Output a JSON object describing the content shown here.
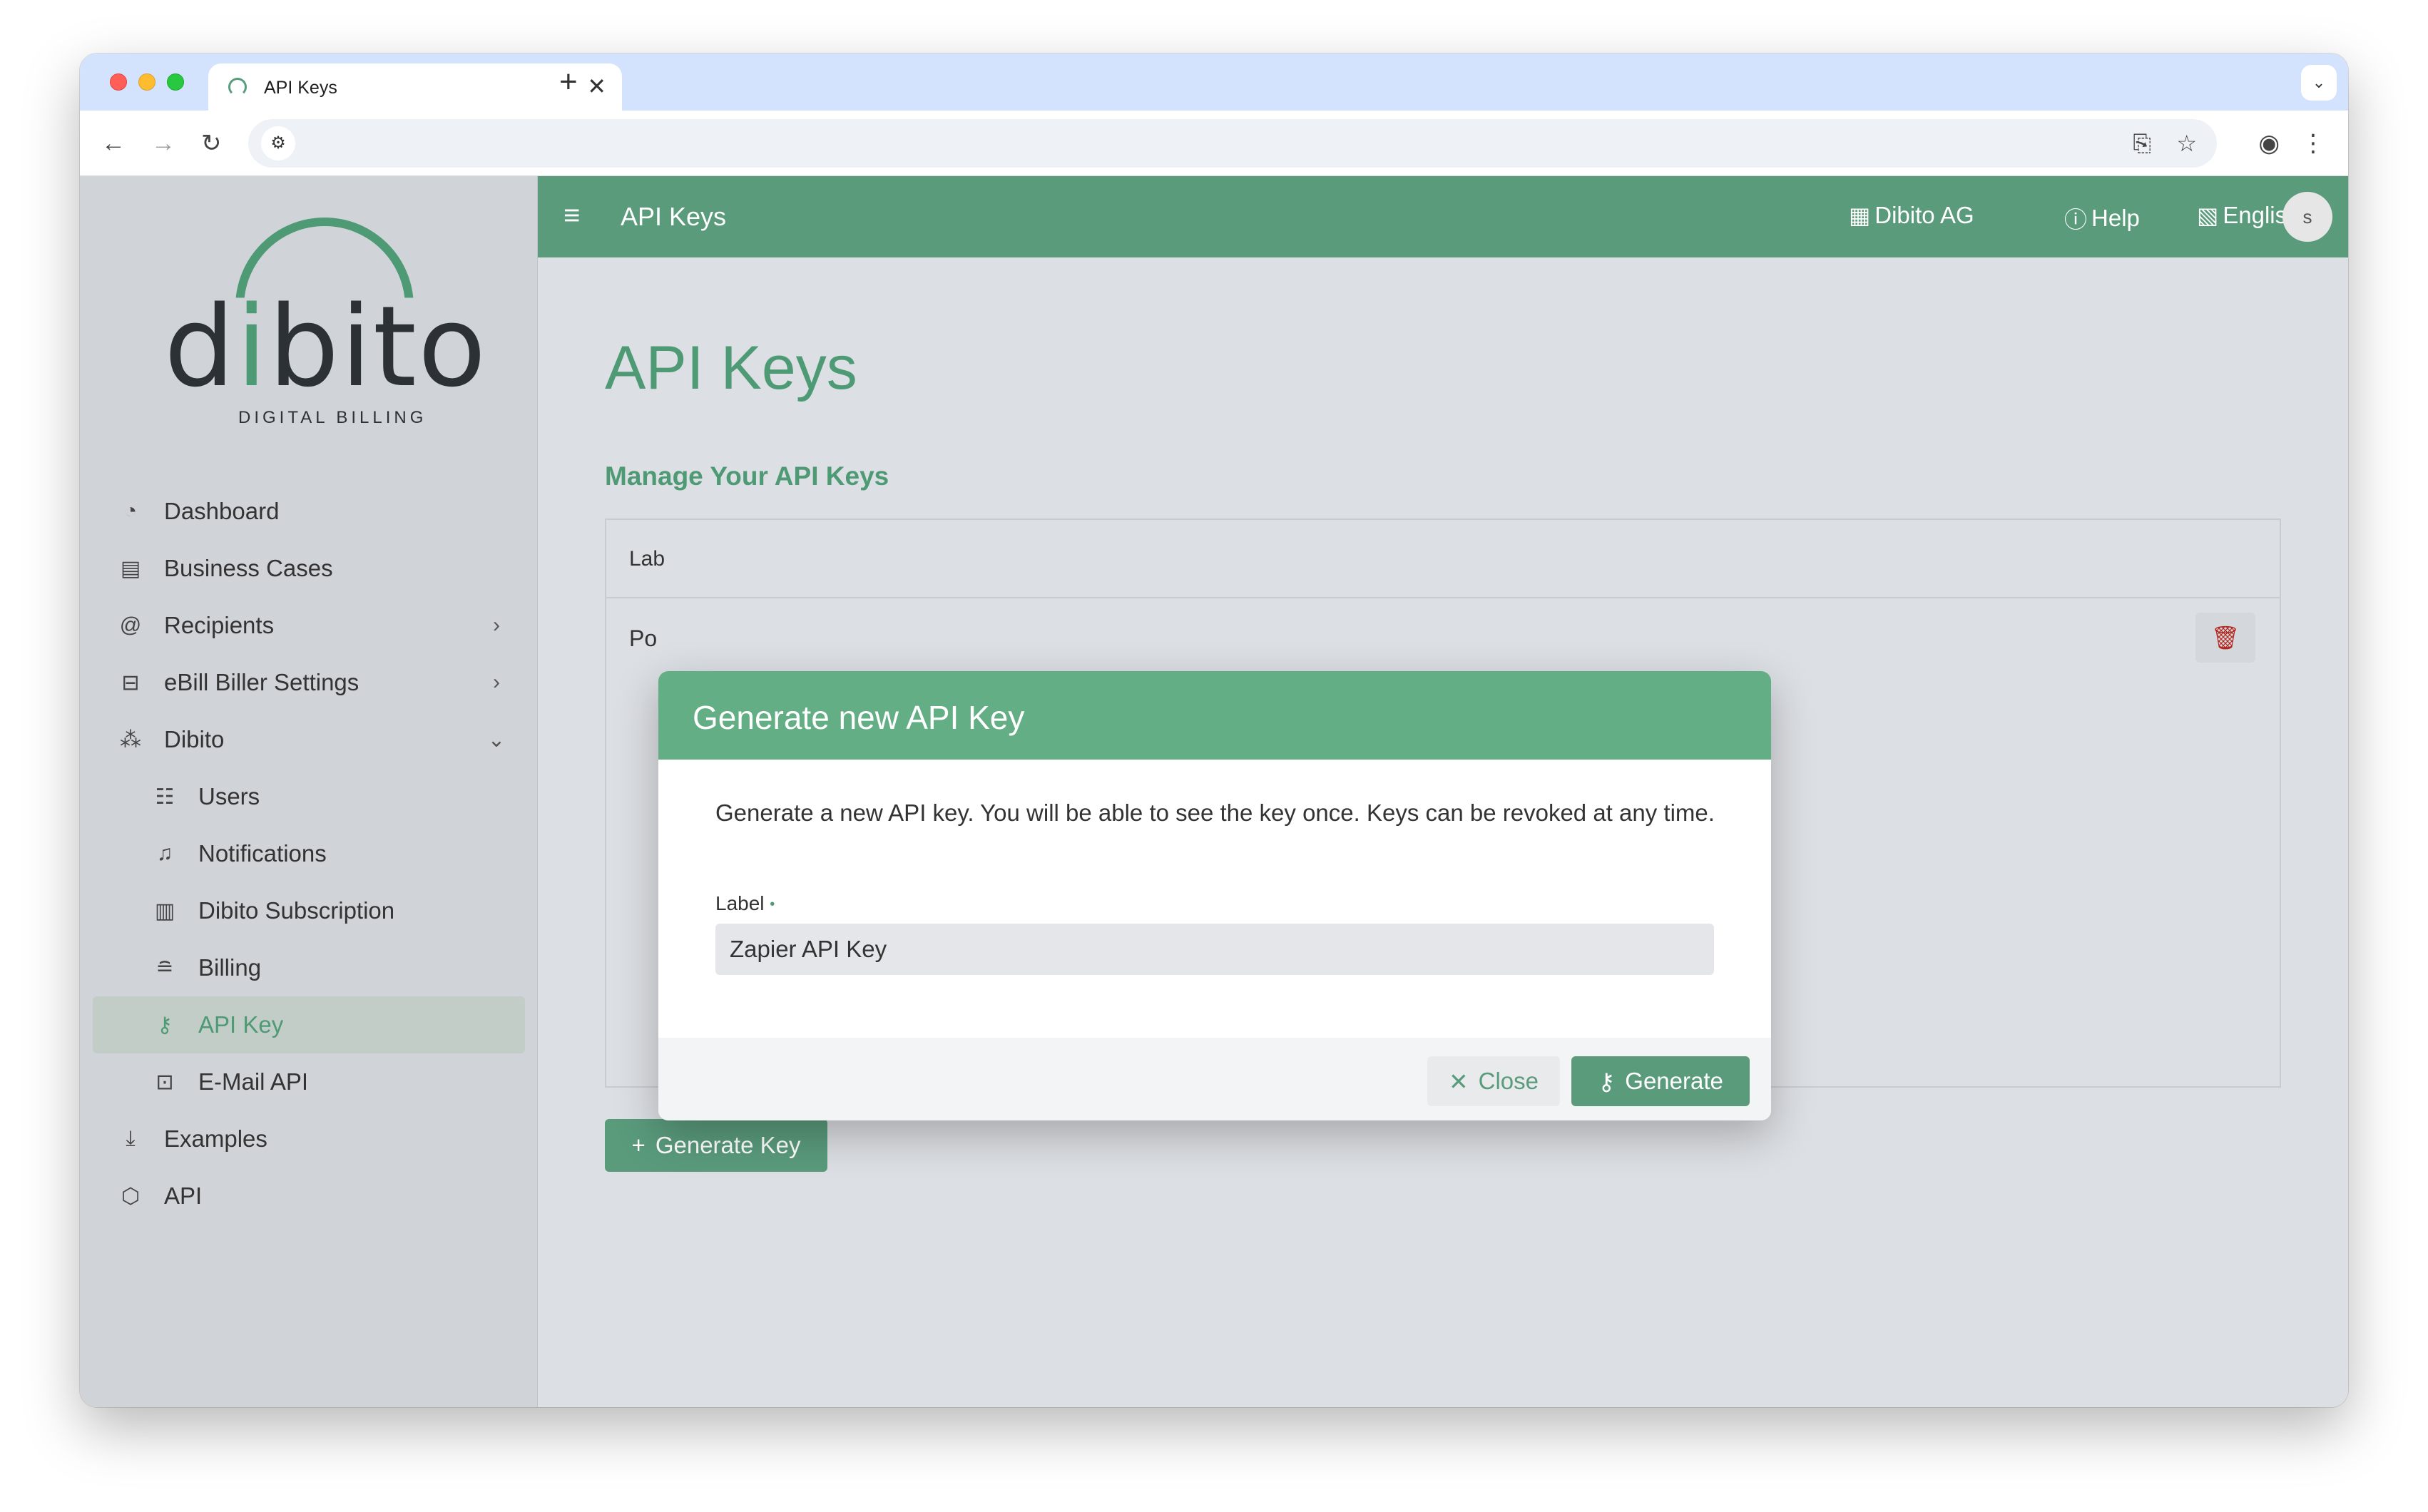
{
  "browser": {
    "tab_title": "API Keys",
    "tab_close": "✕",
    "new_tab": "+",
    "dropdown": "⌄"
  },
  "logo": {
    "word_start": "d",
    "word_i": "i",
    "word_end": "bito",
    "subtitle": "DIGITAL BILLING"
  },
  "sidebar": {
    "items": [
      {
        "label": "Dashboard",
        "icon": "dashboard-icon"
      },
      {
        "label": "Business Cases",
        "icon": "document-icon"
      },
      {
        "label": "Recipients",
        "icon": "at-icon"
      },
      {
        "label": "eBill Biller Settings",
        "icon": "briefcase-icon"
      },
      {
        "label": "Dibito",
        "icon": "group-icon"
      },
      {
        "label": "Users",
        "icon": "users-icon"
      },
      {
        "label": "Notifications",
        "icon": "bell-icon"
      },
      {
        "label": "Dibito Subscription",
        "icon": "receipt-icon"
      },
      {
        "label": "Billing",
        "icon": "coins-icon"
      },
      {
        "label": "API Key",
        "icon": "key-icon"
      },
      {
        "label": "E-Mail API",
        "icon": "inbox-icon"
      },
      {
        "label": "Examples",
        "icon": "file-download-icon"
      },
      {
        "label": "API",
        "icon": "api-icon"
      }
    ]
  },
  "topbar": {
    "title": "API Keys",
    "company": "Dibito AG",
    "help": "Help",
    "language": "English",
    "avatar": "s"
  },
  "main": {
    "page_title": "API Keys",
    "section_title": "Manage Your API Keys",
    "table_header_label": "Lab",
    "table_row_label": "Po",
    "generate_key_button": "Generate Key"
  },
  "modal": {
    "title": "Generate new API Key",
    "description": "Generate a new API key. You will be able to see the key once. Keys can be revoked at any time.",
    "field_label": "Label",
    "field_value": "Zapier API Key",
    "close_button": "Close",
    "generate_button": "Generate"
  },
  "colors": {
    "brand_green": "#5a9b7c",
    "modal_header": "#63ae84",
    "delete_red": "#b3261e"
  }
}
